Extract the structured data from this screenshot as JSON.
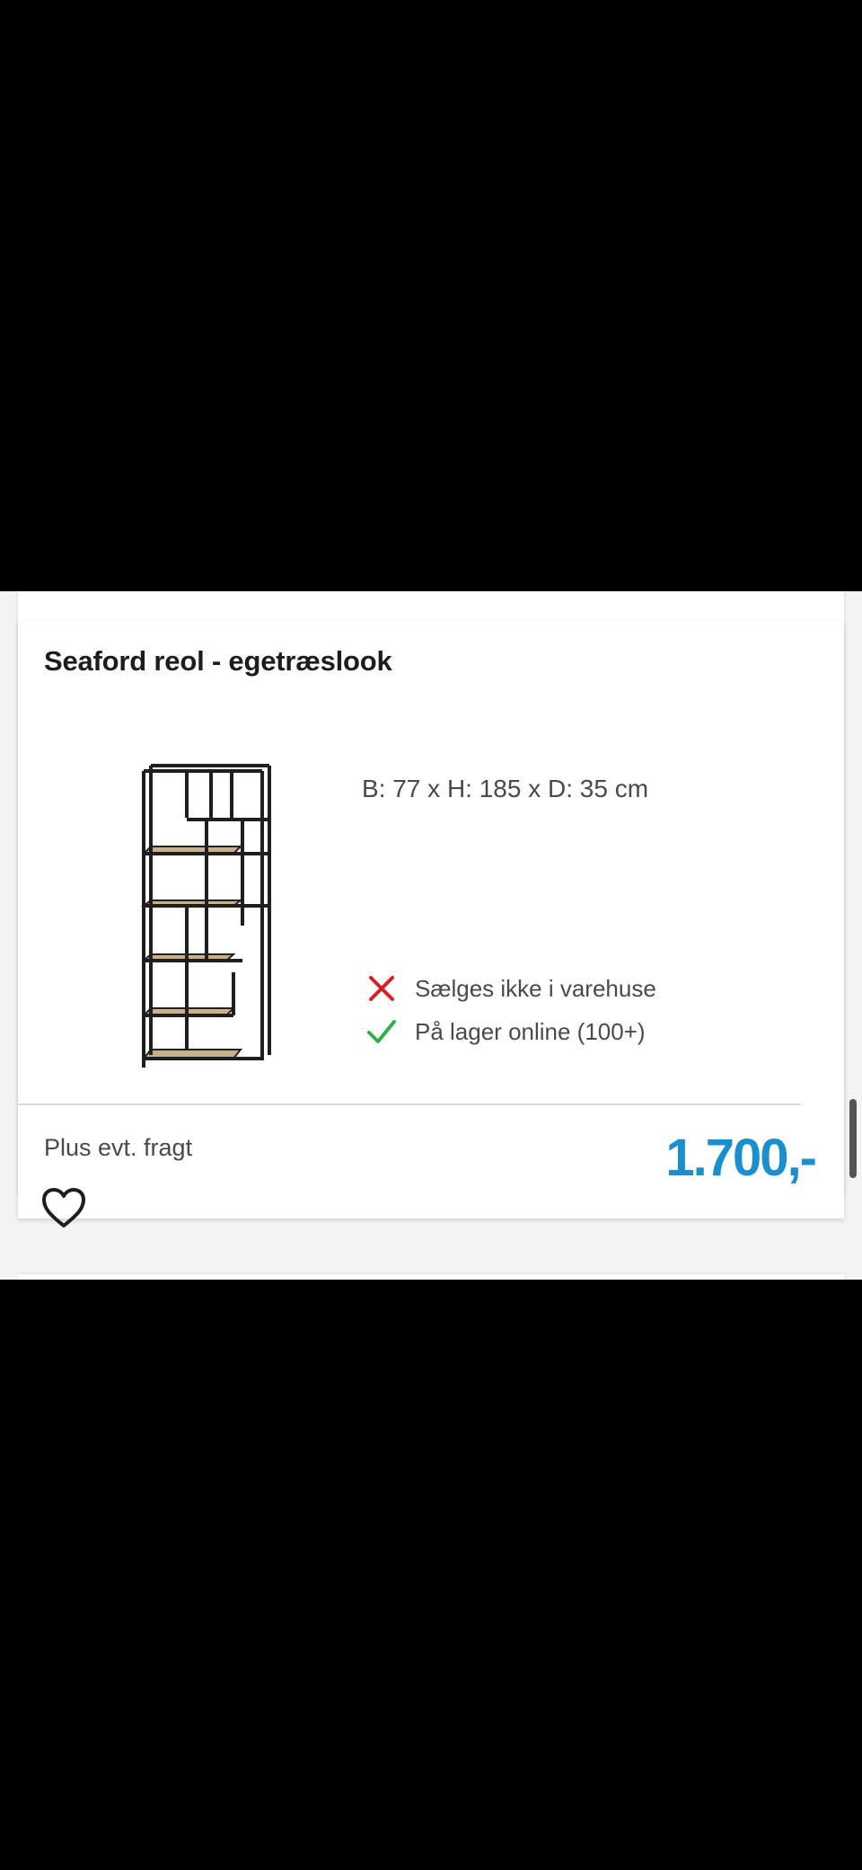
{
  "product": {
    "title": "Seaford reol - egetræslook",
    "dimensions": "B: 77 x H: 185 x D: 35 cm",
    "image_icon": "bookshelf-image"
  },
  "availability": [
    {
      "icon": "x-icon",
      "text": "Sælges ikke i varehuse",
      "color": "#d91f26"
    },
    {
      "icon": "check-icon",
      "text": "På lager online (100+)",
      "color": "#2fb14a"
    }
  ],
  "pricing": {
    "shipping_note": "Plus evt. fragt",
    "price": "1.700,-",
    "price_color": "#1a8fd0"
  },
  "actions": {
    "favorite_icon": "heart-icon"
  }
}
